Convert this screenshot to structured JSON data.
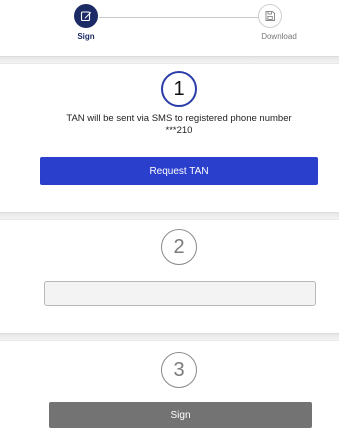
{
  "stepper": {
    "steps": [
      {
        "label": "Sign",
        "icon": "edit-icon",
        "state": "active"
      },
      {
        "label": "Download",
        "icon": "save-icon",
        "state": "inactive"
      }
    ]
  },
  "section1": {
    "number": "1",
    "info_line1": "TAN will be sent via SMS to registered phone number",
    "info_line2": "***210",
    "button_label": "Request TAN"
  },
  "section2": {
    "number": "2",
    "input_value": "",
    "input_placeholder": ""
  },
  "section3": {
    "number": "3",
    "button_label": "Sign"
  },
  "colors": {
    "primary": "#2b3fcd",
    "active_step": "#1c2b66",
    "disabled_button": "#737373"
  }
}
